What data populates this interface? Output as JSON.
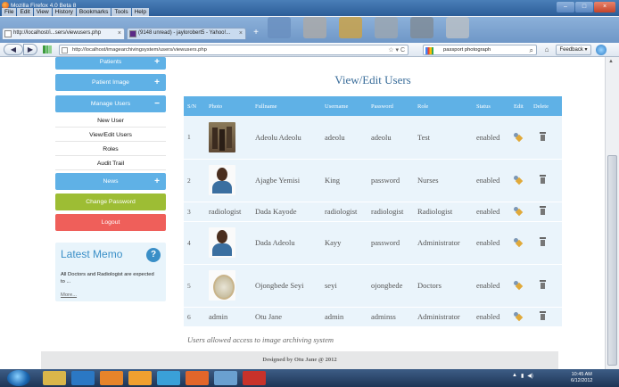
{
  "window": {
    "title": "Mozilla Firefox 4.0 Beta 8"
  },
  "menu": [
    "File",
    "Edit",
    "View",
    "History",
    "Bookmarks",
    "Tools",
    "Help"
  ],
  "tabs": [
    {
      "label": "http://localhost/i...sers/viewusers.php",
      "close": "×"
    },
    {
      "label": "(9148 unread) - jaylorobert5 - Yahoo!...",
      "close": "×"
    }
  ],
  "new_tab": "+",
  "address_bar": {
    "url": "http://localhost/imagearchivingsystem/users/viewusers.php"
  },
  "search_bar": {
    "value": "passport photograph"
  },
  "feedback_button": "Feedback ▾",
  "sidebar": {
    "patients": {
      "label": "Patients",
      "toggle": "+"
    },
    "patient_image": {
      "label": "Patient Image",
      "toggle": "+"
    },
    "manage_users": {
      "label": "Manage Users",
      "toggle": "−"
    },
    "sub_items": [
      "New User",
      "View/Edit Users",
      "Roles",
      "Audit Trail"
    ],
    "news": {
      "label": "News",
      "toggle": "+"
    },
    "change_password": "Change Password",
    "logout": "Logout"
  },
  "memo": {
    "title": "Latest Memo",
    "icon_glyph": "?",
    "body": "All Doctors and Radiologist are expected to ...",
    "more": "More..."
  },
  "main": {
    "heading": "View/Edit Users",
    "columns": [
      "S/N",
      "Photo",
      "Fullname",
      "Username",
      "Password",
      "Role",
      "Status",
      "Edit",
      "Delete"
    ],
    "rows": [
      {
        "sn": "1",
        "photo": "group-photo",
        "photo_text": "",
        "fullname": "Adeolu Adeolu",
        "username": "adeolu",
        "password": "adeolu",
        "role": "Test",
        "status": "enabled"
      },
      {
        "sn": "2",
        "photo": "portrait-photo",
        "photo_text": "",
        "fullname": "Ajagbe Yemisi",
        "username": "King",
        "password": "password",
        "role": "Nurses",
        "status": "enabled"
      },
      {
        "sn": "3",
        "photo": "none",
        "photo_text": "radiologist",
        "fullname": "Dada Kayode",
        "username": "radiologist",
        "password": "radiologist",
        "role": "Radiologist",
        "status": "enabled"
      },
      {
        "sn": "4",
        "photo": "portrait-photo",
        "photo_text": "",
        "fullname": "Dada Adeolu",
        "username": "Kayy",
        "password": "password",
        "role": "Administrator",
        "status": "enabled"
      },
      {
        "sn": "5",
        "photo": "seal-photo",
        "photo_text": "",
        "fullname": "Ojongbede Seyi",
        "username": "seyi",
        "password": "ojongbede",
        "role": "Doctors",
        "status": "enabled"
      },
      {
        "sn": "6",
        "photo": "none",
        "photo_text": "admin",
        "fullname": "Otu Jane",
        "username": "admin",
        "password": "adminss",
        "role": "Administrator",
        "status": "enabled"
      }
    ],
    "caption": "Users allowed access to image archiving system"
  },
  "footer": "Designed by Otu Jane @ 2012",
  "taskbar": {
    "time": "10:45 AM",
    "date": "6/12/2012"
  }
}
